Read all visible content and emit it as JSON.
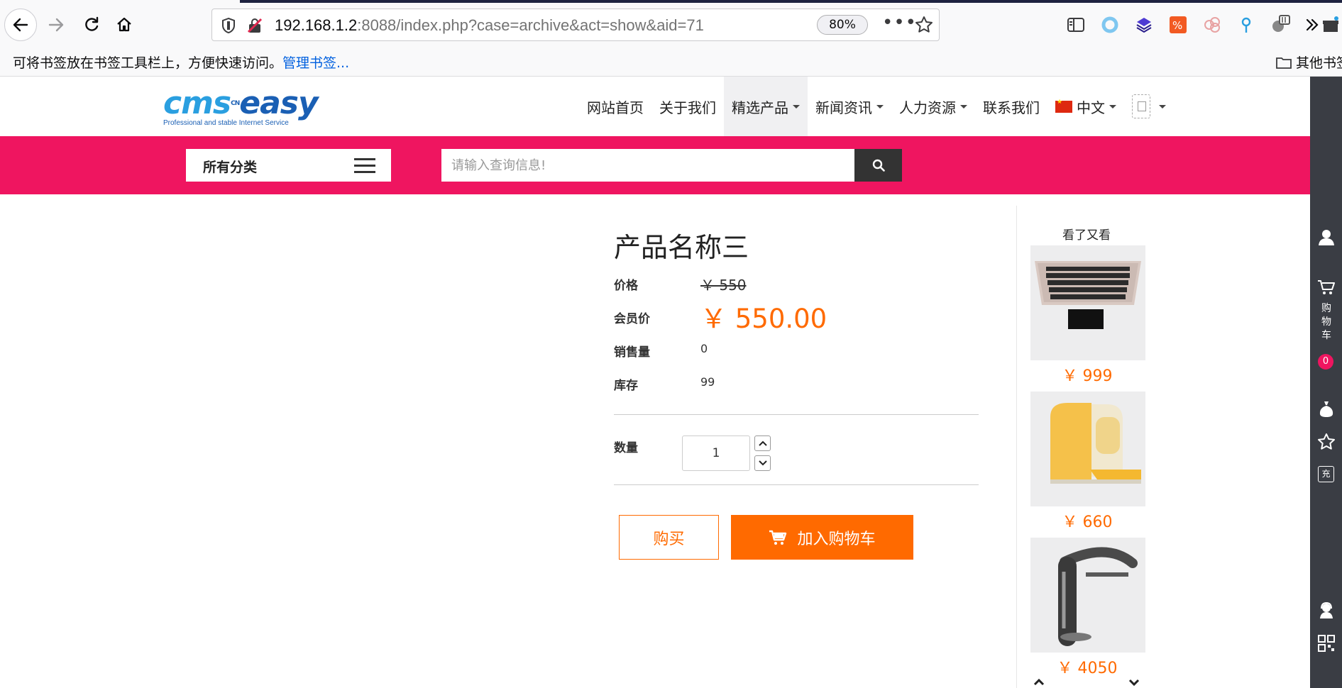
{
  "browser": {
    "url_host": "192.168.1.2",
    "url_rest": ":8088/index.php?case=archive&act=show&aid=71",
    "zoom": "80%",
    "bookmarks_hint": "可将书签放在书签工具栏上，方便快速访问。",
    "bookmarks_manage": "管理书签...",
    "other_bookmarks": "其他书签"
  },
  "site": {
    "logo_main": "cms",
    "logo_second": "easy",
    "logo_tm": "CN",
    "logo_tagline": "Professional and stable Internet Service",
    "nav": [
      {
        "label": "网站首页"
      },
      {
        "label": "关于我们"
      },
      {
        "label": "精选产品"
      },
      {
        "label": "新闻资讯"
      },
      {
        "label": "人力资源"
      },
      {
        "label": "联系我们"
      },
      {
        "label": "中文"
      }
    ],
    "category_label": "所有分类",
    "search_placeholder": "请输入查询信息!"
  },
  "product": {
    "title": "产品名称三",
    "price_label": "价格",
    "price_value": "￥ 550",
    "member_price_label": "会员价",
    "member_price_value": "￥ 550.00",
    "sales_label": "销售量",
    "sales_value": "0",
    "stock_label": "库存",
    "stock_value": "99",
    "qty_label": "数量",
    "qty_value": "1",
    "buy_label": "购买",
    "cart_label": "加入购物车"
  },
  "viewed": {
    "title": "看了又看",
    "items": [
      {
        "price": "￥ 999",
        "icon": "laptop"
      },
      {
        "price": "￥ 660",
        "icon": "yellow-appliance"
      },
      {
        "price": "￥ 4050",
        "icon": "faucet"
      }
    ]
  },
  "sidebar": {
    "cart_label": "购物车",
    "cart_count": "0",
    "chong_label": "充"
  },
  "colors": {
    "accent_pink": "#ef1560",
    "accent_orange": "#ff6a00",
    "sidebar_dark": "#3a3d44"
  }
}
